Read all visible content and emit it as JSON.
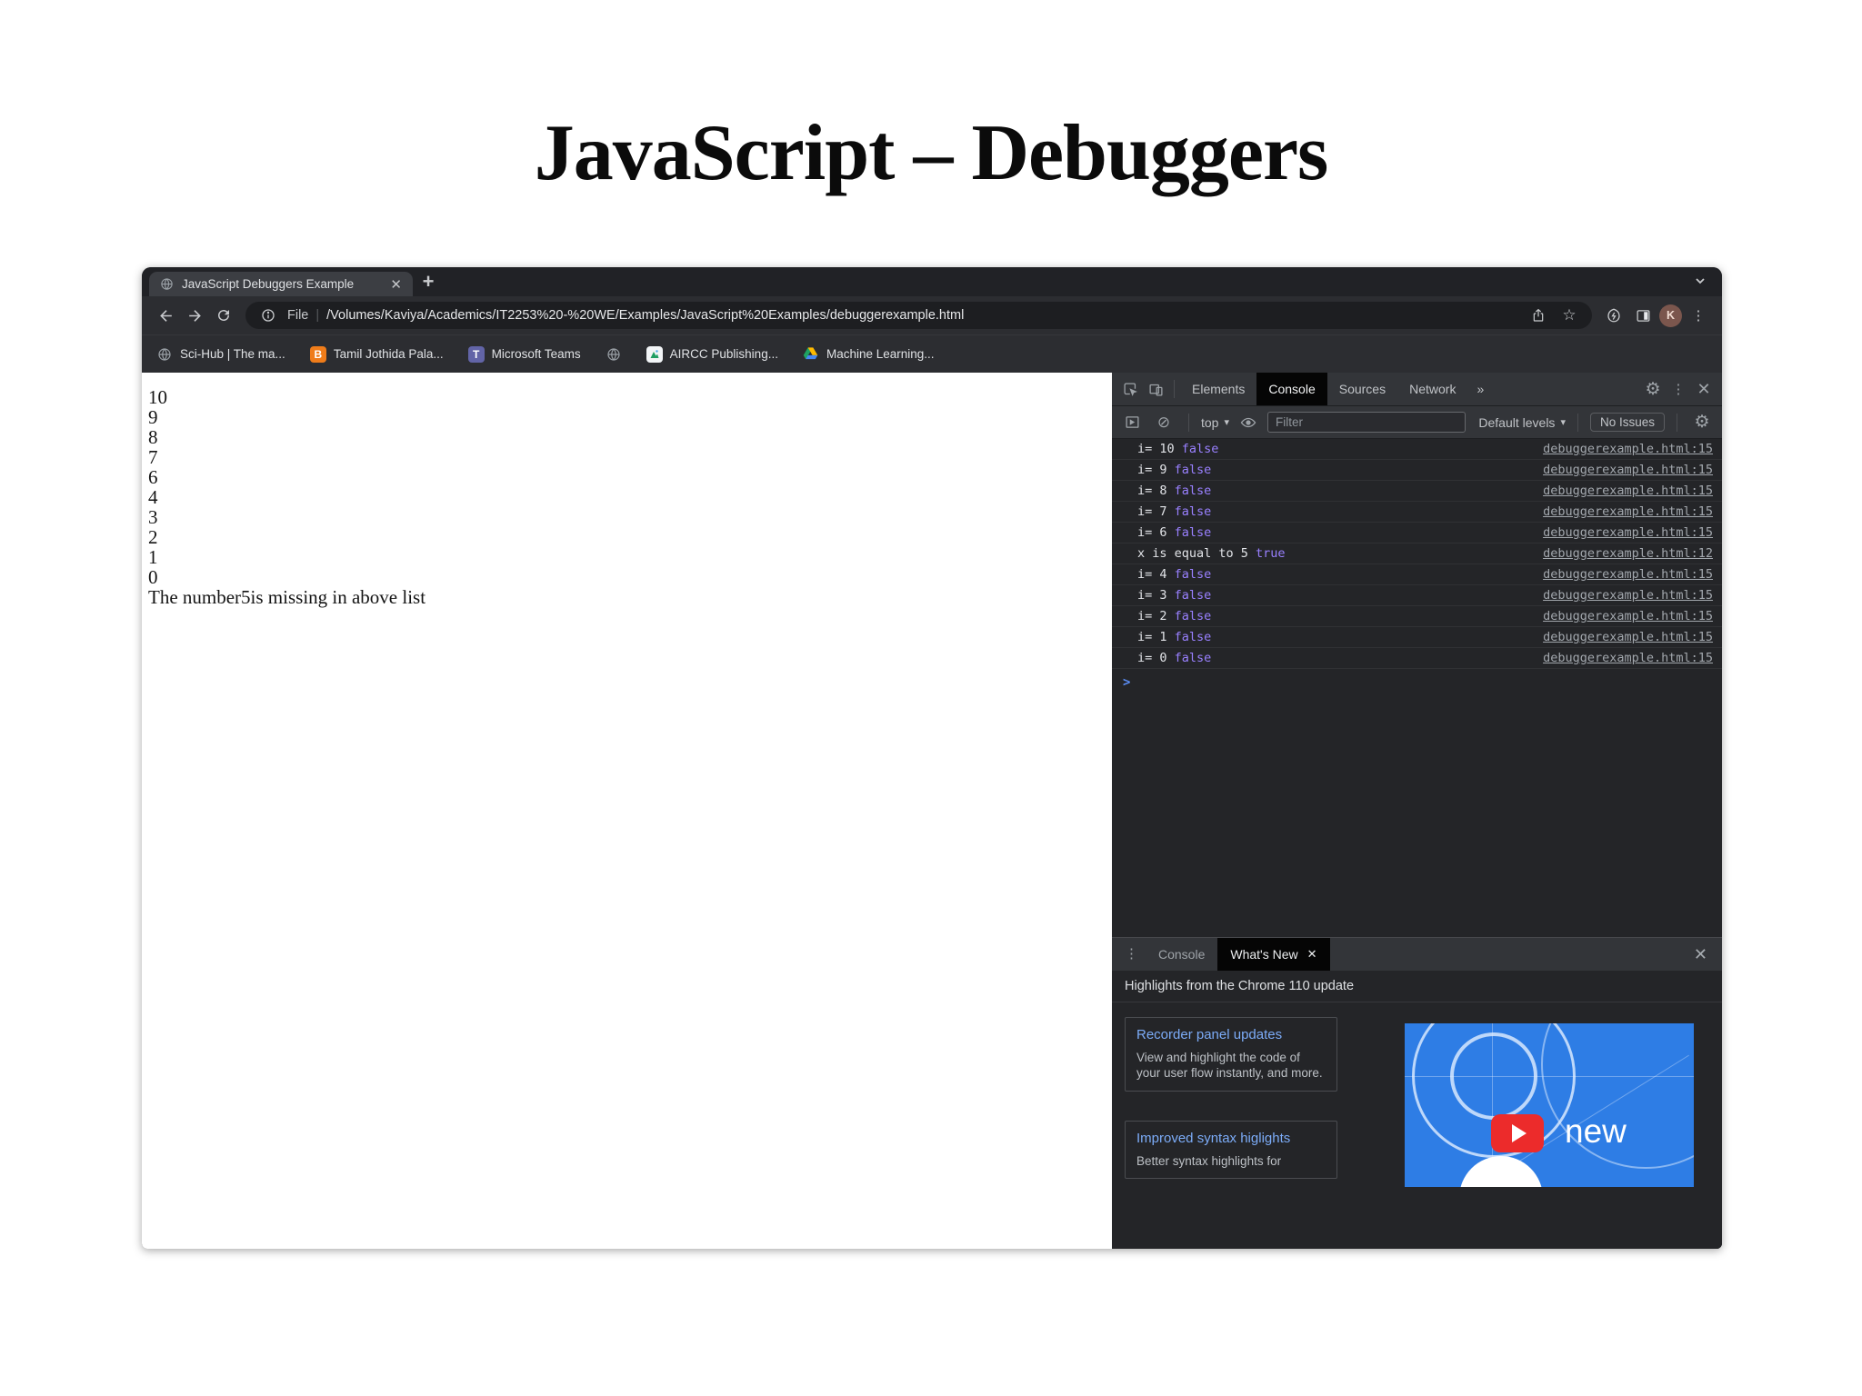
{
  "title": "JavaScript – Debuggers",
  "browser": {
    "tab_title": "JavaScript Debuggers Example",
    "url_scheme_label": "File",
    "url": "/Volumes/Kaviya/Academics/IT2253%20-%20WE/Examples/JavaScript%20Examples/debuggerexample.html",
    "avatar_initial": "K",
    "bookmarks": [
      {
        "icon": "globe",
        "label": "Sci-Hub | The ma..."
      },
      {
        "icon": "blogger",
        "label": "Tamil Jothida Pala..."
      },
      {
        "icon": "teams",
        "label": "Microsoft Teams"
      },
      {
        "icon": "globe",
        "label": ""
      },
      {
        "icon": "aircc",
        "label": "AIRCC Publishing..."
      },
      {
        "icon": "drive",
        "label": "Machine Learning..."
      }
    ]
  },
  "page_output": {
    "lines": [
      "10",
      "9",
      "8",
      "7",
      "6",
      "4",
      "3",
      "2",
      "1",
      "0"
    ],
    "note": "The number5is missing in above list"
  },
  "devtools": {
    "panel_tabs": [
      "Elements",
      "Console",
      "Sources",
      "Network"
    ],
    "active_panel_tab": "Console",
    "more_tabs_glyph": "»",
    "console_toolbar": {
      "context_selector": "top",
      "filter_placeholder": "Filter",
      "levels_label": "Default levels",
      "issues_label": "No Issues"
    },
    "messages": [
      {
        "msg": "i= 10",
        "val": "false",
        "src": "debuggerexample.html:15"
      },
      {
        "msg": "i= 9",
        "val": "false",
        "src": "debuggerexample.html:15"
      },
      {
        "msg": "i= 8",
        "val": "false",
        "src": "debuggerexample.html:15"
      },
      {
        "msg": "i= 7",
        "val": "false",
        "src": "debuggerexample.html:15"
      },
      {
        "msg": "i= 6",
        "val": "false",
        "src": "debuggerexample.html:15"
      },
      {
        "msg": "x is equal to 5",
        "val": "true",
        "src": "debuggerexample.html:12"
      },
      {
        "msg": "i= 4",
        "val": "false",
        "src": "debuggerexample.html:15"
      },
      {
        "msg": "i= 3",
        "val": "false",
        "src": "debuggerexample.html:15"
      },
      {
        "msg": "i= 2",
        "val": "false",
        "src": "debuggerexample.html:15"
      },
      {
        "msg": "i= 1",
        "val": "false",
        "src": "debuggerexample.html:15"
      },
      {
        "msg": "i= 0",
        "val": "false",
        "src": "debuggerexample.html:15"
      }
    ],
    "prompt_glyph": ">",
    "drawer": {
      "tab_console": "Console",
      "tab_whats_new": "What's New"
    },
    "whats_new": {
      "heading": "Highlights from the Chrome 110 update",
      "cards": [
        {
          "title": "Recorder panel updates",
          "body": "View and highlight the code of your user flow instantly, and more."
        },
        {
          "title": "Improved syntax higlights",
          "body": "Better syntax highlights for"
        }
      ],
      "video_badge": "new"
    }
  },
  "colors": {
    "boolean_violet": "#9980ff",
    "link_blue": "#7cacf8",
    "thumb_blue": "#2e7de5",
    "youtube_red": "#ec2b2b"
  }
}
